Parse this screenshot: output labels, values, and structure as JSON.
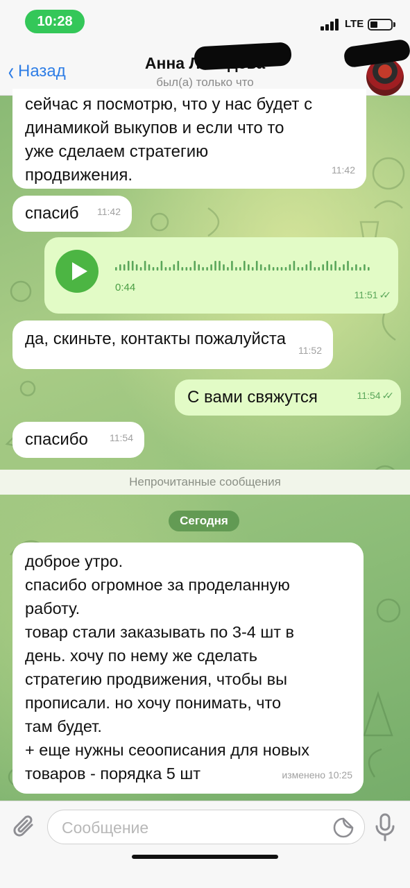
{
  "status_bar": {
    "time": "10:28",
    "network": "LTE"
  },
  "nav": {
    "back_label": "Назад",
    "title": "Анна Лебедева",
    "subtitle": "был(а) только что"
  },
  "messages": [
    {
      "direction": "in",
      "text": "сейчас я посмотрю, что у нас будет с\nдинамикой выкупов и если что то\nуже сделаем стратегию\nпродвижения.",
      "time": "11:42"
    },
    {
      "direction": "in",
      "text": "спасиб",
      "time": "11:42"
    },
    {
      "direction": "out",
      "type": "voice",
      "duration": "0:44",
      "time": "11:51",
      "status": "read"
    },
    {
      "direction": "in",
      "text": "да, скиньте, контакты пожалуйста",
      "time": "11:52"
    },
    {
      "direction": "out",
      "text": "С вами свяжутся",
      "time": "11:54",
      "status": "read"
    },
    {
      "direction": "in",
      "text": "спасибо",
      "time": "11:54"
    }
  ],
  "unread_divider": "Непрочитанные сообщения",
  "date_divider": "Сегодня",
  "today_message": {
    "text": "доброе утро.\nспасибо огромное за проделанную\nработу.\nтовар стали заказывать по 3-4 шт в\nдень. хочу по нему же сделать\nстратегию продвижения, чтобы вы\nпрописали. но хочу понимать, что\nтам будет.\n+ еще нужны сеоописания для новых\nтоваров - порядка 5 шт",
    "meta": "изменено 10:25"
  },
  "input": {
    "placeholder": "Сообщение"
  },
  "colors": {
    "accent_blue": "#2f7ee6",
    "outgoing_bubble": "#e2fbc6",
    "incoming_bubble": "#ffffff",
    "play_button": "#4cb543",
    "time_pill": "#34c759"
  },
  "icons": [
    "back-chevron-icon",
    "attach-icon",
    "sticker-icon",
    "mic-icon",
    "play-icon",
    "read-checks-icon"
  ]
}
